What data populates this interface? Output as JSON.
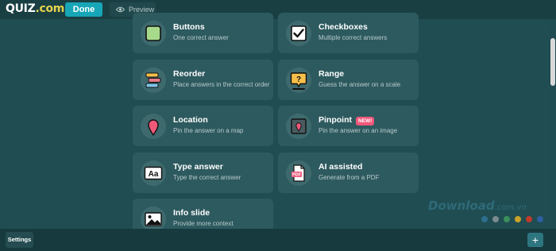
{
  "header": {
    "logo_main": "QUIZ",
    "logo_suffix": ".com",
    "done_label": "Done",
    "preview_label": "Preview"
  },
  "question_types": [
    {
      "title": "Buttons",
      "subtitle": "One correct answer",
      "icon": "square-button-icon"
    },
    {
      "title": "Checkboxes",
      "subtitle": "Multiple correct answers",
      "icon": "checkbox-icon"
    },
    {
      "title": "Reorder",
      "subtitle": "Place answers in the correct order",
      "icon": "reorder-bars-icon"
    },
    {
      "title": "Range",
      "subtitle": "Guess the answer on a scale",
      "icon": "question-bubble-icon"
    },
    {
      "title": "Location",
      "subtitle": "Pin the answer on a map",
      "icon": "map-pin-icon"
    },
    {
      "title": "Pinpoint",
      "subtitle": "Pin the answer on an image",
      "icon": "image-pin-icon",
      "badge": "NEW!"
    },
    {
      "title": "Type answer",
      "subtitle": "Type the correct answer",
      "icon": "text-aa-icon"
    },
    {
      "title": "AI assisted",
      "subtitle": "Generate from a PDF",
      "icon": "pdf-document-icon"
    },
    {
      "title": "Info slide",
      "subtitle": "Provide more context",
      "icon": "picture-icon"
    }
  ],
  "watermark": {
    "main": "Download",
    "suffix": ".com.vn",
    "dot_colors": [
      "#2e6f8e",
      "#7b8a8e",
      "#3a8f5a",
      "#c9a227",
      "#c0392b",
      "#2f5fa3"
    ]
  },
  "footer": {
    "settings_label": "Settings",
    "add_label": "+"
  },
  "colors": {
    "background": "#1f4d52",
    "card": "#2d5a5f",
    "accent": "#17a6b7",
    "badge": "#f0587a"
  }
}
